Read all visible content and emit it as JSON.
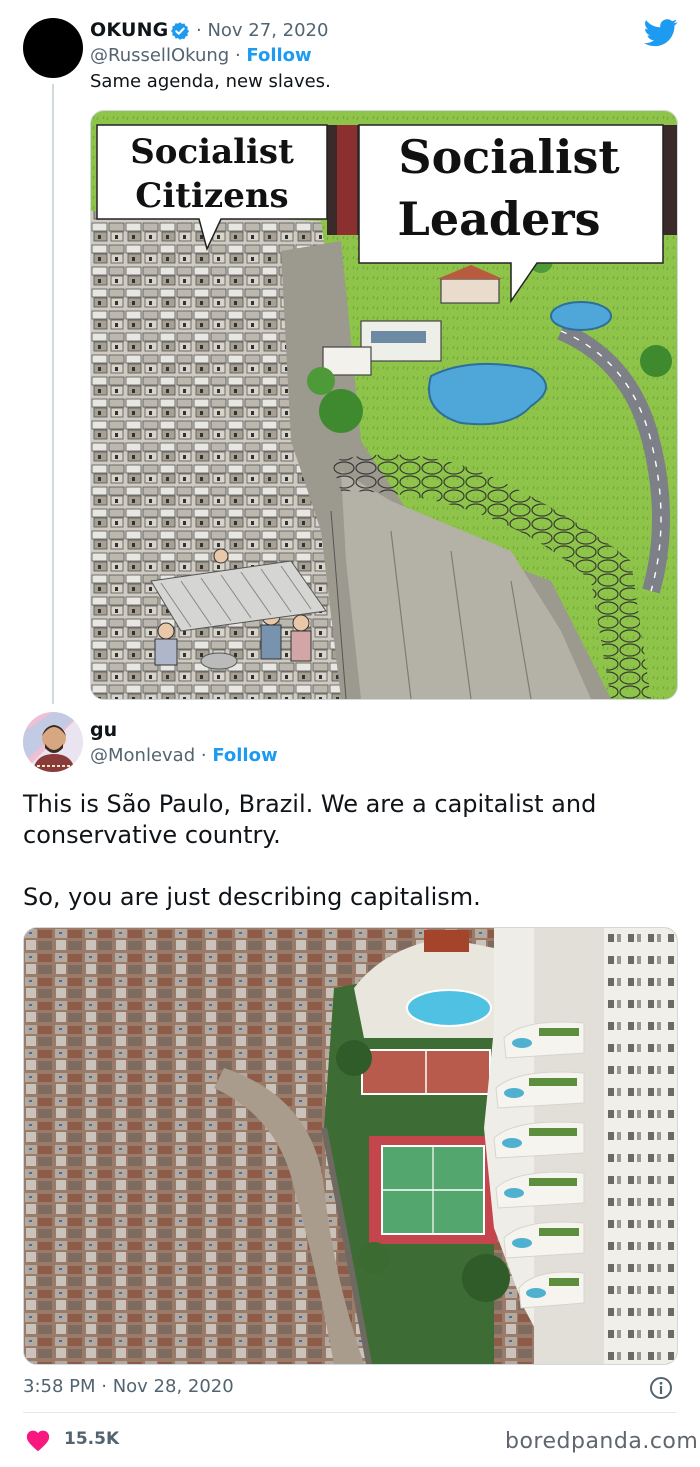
{
  "tweet1": {
    "name": "OKUNG",
    "date": "· Nov 27, 2020",
    "handle": "@RussellOkung",
    "follow_sep": " · ",
    "follow": "Follow",
    "text": "Same agenda, new slaves.",
    "cartoon": {
      "bubble_left": [
        "Socialist",
        "Citizens"
      ],
      "bubble_right": [
        "Socialist",
        "Leaders"
      ]
    }
  },
  "tweet2": {
    "name": "gu",
    "handle": "@Monlevad",
    "follow_sep": " · ",
    "follow": "Follow",
    "text_line1": "This is São Paulo, Brazil. We are a capitalist and conservative country.",
    "text_line2": "So, you are just describing capitalism.",
    "timestamp": "3:58 PM · Nov 28, 2020",
    "likes": "15.5K"
  },
  "watermark": "boredpanda.com",
  "icons": {
    "verified": "verified-badge-icon",
    "twitter": "twitter-bird-icon",
    "info": "info-icon",
    "like": "heart-icon"
  },
  "colors": {
    "accent": "#1d9bf0",
    "like": "#f91880",
    "muted": "#536471"
  }
}
